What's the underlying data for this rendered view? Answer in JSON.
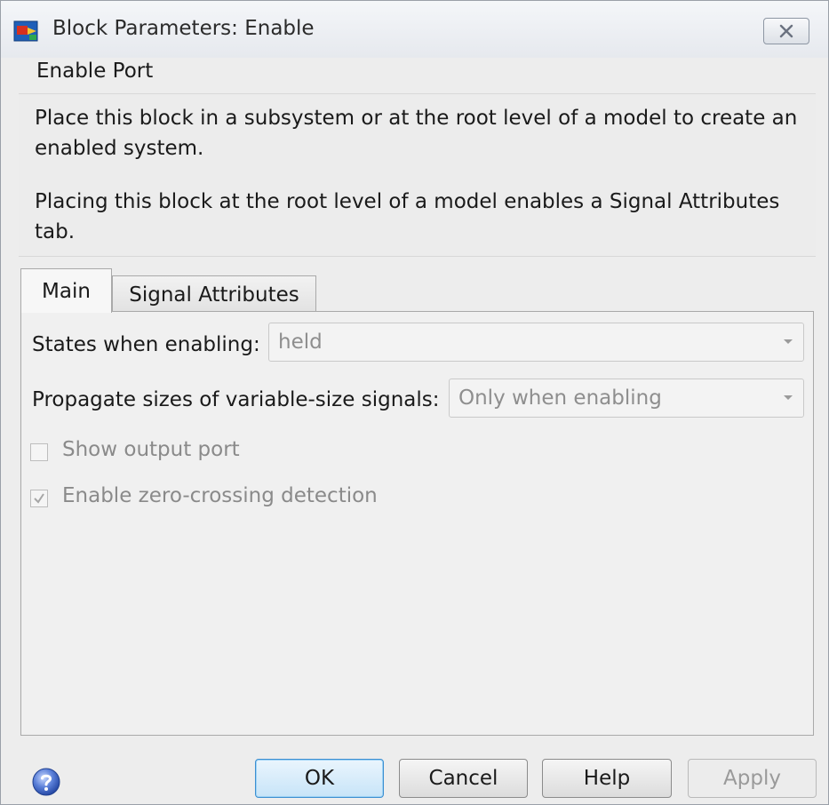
{
  "window": {
    "title": "Block Parameters: Enable"
  },
  "description": {
    "group_label": "Enable Port",
    "paragraph1": "Place this block in a subsystem or at the root level of a model to create an enabled system.",
    "paragraph2": "Placing this block at the root level of a model enables a Signal Attributes tab."
  },
  "tabs": [
    {
      "label": "Main",
      "active": true
    },
    {
      "label": "Signal Attributes",
      "active": false
    }
  ],
  "main": {
    "states_label": "States when enabling:",
    "states_value": "held",
    "propagate_label": "Propagate sizes of variable-size signals:",
    "propagate_value": "Only when enabling",
    "show_output_label": "Show output port",
    "show_output_checked": false,
    "zero_crossing_label": "Enable zero-crossing detection",
    "zero_crossing_checked": true
  },
  "buttons": {
    "ok": "OK",
    "cancel": "Cancel",
    "help": "Help",
    "apply": "Apply"
  },
  "icons": {
    "app": "simulink-block-icon",
    "close": "close-icon",
    "help": "help-question-icon"
  }
}
